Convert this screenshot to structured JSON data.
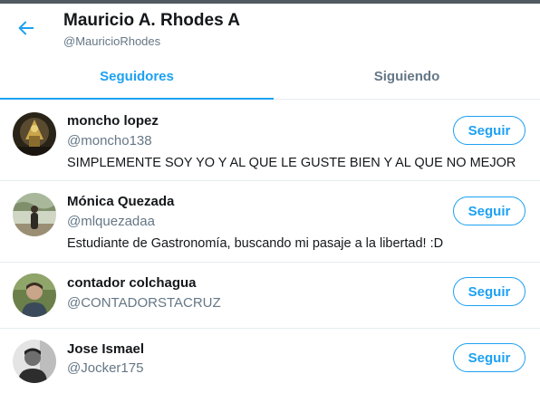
{
  "header": {
    "title": "Mauricio A. Rhodes A",
    "handle": "@MauricioRhodes"
  },
  "tabs": [
    {
      "label": "Seguidores",
      "active": true
    },
    {
      "label": "Siguiendo",
      "active": false
    }
  ],
  "users": [
    {
      "name": "moncho lopez",
      "handle": "@moncho138",
      "bio": "SIMPLEMENTE SOY YO Y AL QUE LE GUSTE BIEN Y AL QUE NO MEJOR",
      "button": "Seguir"
    },
    {
      "name": "Mónica Quezada",
      "handle": "@mlquezadaa",
      "bio": "Estudiante de Gastronomía, buscando mi pasaje a la libertad! :D",
      "button": "Seguir"
    },
    {
      "name": "contador colchagua",
      "handle": "@CONTADORSTACRUZ",
      "bio": "",
      "button": "Seguir"
    },
    {
      "name": "Jose Ismael",
      "handle": "@Jocker175",
      "bio": "",
      "button": "Seguir"
    }
  ],
  "colors": {
    "accent": "#1da1f2",
    "muted": "#657786",
    "divider": "#e6ecf0"
  }
}
